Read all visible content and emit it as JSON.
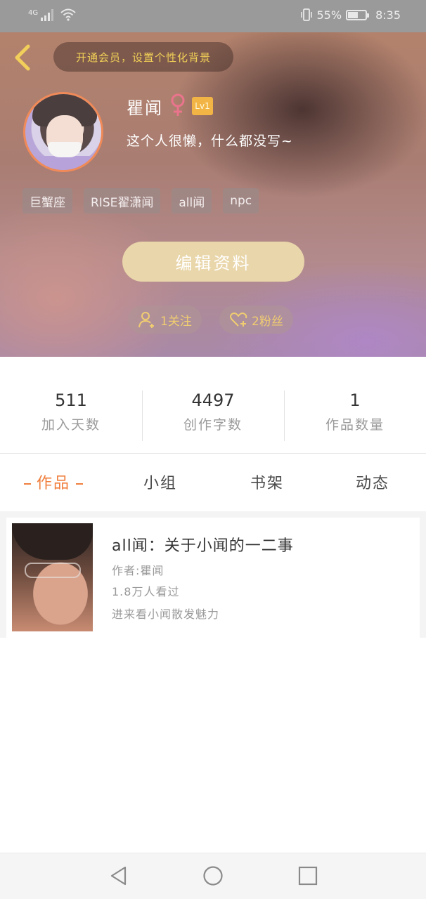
{
  "status_bar": {
    "network": "4G",
    "battery_percent": "55%",
    "time": "8:35"
  },
  "header": {
    "vip_banner": "开通会员，设置个性化背景",
    "username": "瞿闻",
    "level": "Lv1",
    "bio": "这个人很懒，什么都没写~",
    "tags": [
      "巨蟹座",
      "RISE翟潇闻",
      "all闻",
      "npc"
    ],
    "edit_button": "编辑资料",
    "following": "1关注",
    "followers": "2粉丝"
  },
  "stats": [
    {
      "value": "511",
      "label": "加入天数"
    },
    {
      "value": "4497",
      "label": "创作字数"
    },
    {
      "value": "1",
      "label": "作品数量"
    }
  ],
  "tabs": [
    {
      "label": "作品",
      "active": true
    },
    {
      "label": "小组",
      "active": false
    },
    {
      "label": "书架",
      "active": false
    },
    {
      "label": "动态",
      "active": false
    }
  ],
  "works": [
    {
      "title": "all闻：关于小闻的一二事",
      "author": "作者:瞿闻",
      "views": "1.8万人看过",
      "summary": "进来看小闻散发魅力"
    }
  ],
  "colors": {
    "accent": "#f07e3c",
    "gold": "#f0cd70",
    "edit_button": "#e9d6aa",
    "level_badge": "#f2b545"
  },
  "icons": {
    "back": "chevron-left-icon",
    "gender": "female-icon",
    "follow": "add-user-icon",
    "fans": "heart-plus-icon"
  }
}
